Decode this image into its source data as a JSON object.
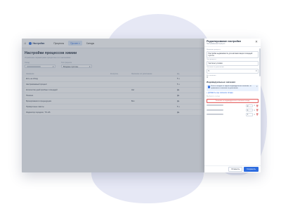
{
  "topbar": {
    "brand": "Настройки",
    "nav": [
      "Процессы",
      "Прочее",
      "Склады"
    ]
  },
  "page": {
    "title": "Настройки процессов химии",
    "subtitle": "Управление параметрами процессов и их значениями",
    "filters": [
      {
        "label": "Склад",
        "value": "",
        "blurred": true
      },
      {
        "label": "Тип процесса",
        "value": "Входные пустоны",
        "blurred": false
      }
    ]
  },
  "table": {
    "headers": [
      "Название",
      "Контроль",
      "Значение по умолчанию",
      "Ед."
    ],
    "rows": [
      [
        "Есть на обход",
        "",
        "",
        "5 ч."
      ],
      [
        "Настраиваемый процесс",
        "",
        "",
        "5 ч."
      ],
      [
        "Количество дней пробных площадей",
        "",
        "Нет",
        "Дн."
      ],
      [
        "Полезно",
        "",
        "",
        "Дн."
      ],
      [
        "Бронирования в предыдущем",
        "",
        "Вкл",
        "Дн."
      ],
      [
        "Проверочные пакеты",
        "",
        "",
        "5 ч."
      ],
      [
        "Индикатор передачи, TO-HS",
        "",
        "",
        "Дн."
      ]
    ]
  },
  "drawer": {
    "title": "Редактирование настройки",
    "subtitle": "Настраиваемый процесс",
    "fields": [
      {
        "label": "Название процесса",
        "value": "Настройки недвижимости для автоматизации площадей пустоте"
      },
      {
        "label": "Тип процесса",
        "value": "Частично условия"
      },
      {
        "label": "Значение по умолчанию",
        "value": "5"
      },
      {
        "label": "Ед. значения",
        "value": "Ч"
      }
    ],
    "section": "Индивидуальные значения",
    "info_text": "Если в складах не задано индивидуальное значение, то применяется значение по умолчанию",
    "add_link": "Добавить еще значение склада",
    "ghost_placeholder": "Выберите склад",
    "error_text": "Значение не индивидуального значения склада",
    "rows": [
      {
        "value": "2"
      },
      {
        "value": "1"
      },
      {
        "value": "1"
      }
    ],
    "cancel": "Отменить",
    "save": "Сохранить"
  },
  "colors": {
    "accent": "#2d6cdf",
    "error": "#d24040"
  }
}
